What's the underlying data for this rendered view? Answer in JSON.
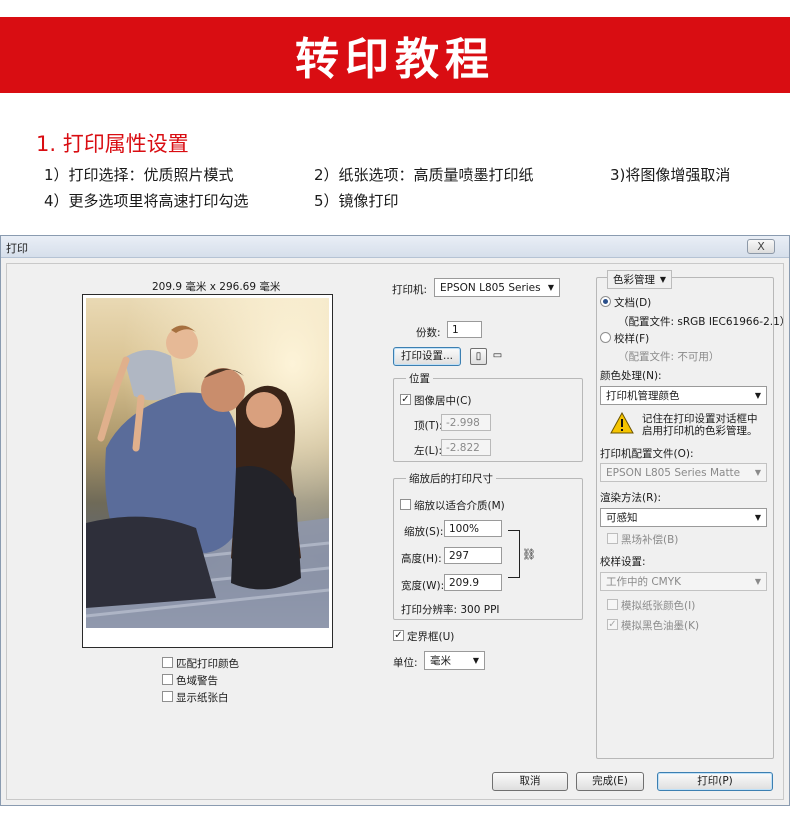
{
  "banner": {
    "title": "转印教程"
  },
  "steps": {
    "title": "1. 打印属性设置",
    "s1": "1）打印选择：优质照片模式",
    "s2": "2）纸张选项：高质量喷墨打印纸",
    "s3": "3)将图像增强取消",
    "s4": "4）更多选项里将高速打印勾选",
    "s5": "5）镜像打印"
  },
  "dialog": {
    "title": "打印",
    "close": "X",
    "preview": {
      "size_label": "209.9 毫米 x 296.69 毫米",
      "match_colors": "匹配打印颜色",
      "gamut_warning": "色域警告",
      "show_paper_white": "显示纸张白"
    },
    "printer": {
      "printer_label": "打印机:",
      "printer_value": "EPSON L805 Series",
      "copies_label": "份数:",
      "copies_value": "1",
      "print_settings": "打印设置..."
    },
    "position": {
      "title": "位置",
      "center_image": "图像居中(C)",
      "top_label": "顶(T):",
      "top_value": "-2.998",
      "left_label": "左(L):",
      "left_value": "-2.822"
    },
    "scaled": {
      "title": "缩放后的打印尺寸",
      "scale_to_fit": "缩放以适合介质(M)",
      "scale_label": "缩放(S):",
      "scale_value": "100%",
      "height_label": "高度(H):",
      "height_value": "297",
      "width_label": "宽度(W):",
      "width_value": "209.9",
      "resolution": "打印分辨率: 300 PPI"
    },
    "bounding_box": "定界框(U)",
    "units_label": "单位:",
    "units_value": "毫米",
    "color": {
      "mode": "色彩管理",
      "document": "文档(D)",
      "document_profile": "（配置文件: sRGB IEC61966-2.1）",
      "proof": "校样(F)",
      "proof_profile": "（配置文件: 不可用）",
      "handling_label": "颜色处理(N):",
      "handling_value": "打印机管理颜色",
      "warning": "记住在打印设置对话框中启用打印机的色彩管理。",
      "printer_profile_label": "打印机配置文件(O):",
      "printer_profile_value": "EPSON L805 Series Matte",
      "render_label": "渲染方法(R):",
      "render_value": "可感知",
      "black_point": "黑场补偿(B)",
      "proof_setup_label": "校样设置:",
      "proof_setup_value": "工作中的 CMYK",
      "sim_paper": "模拟纸张颜色(I)",
      "sim_black": "模拟黑色油墨(K)"
    },
    "buttons": {
      "cancel": "取消",
      "done": "完成(E)",
      "print": "打印(P)"
    }
  }
}
